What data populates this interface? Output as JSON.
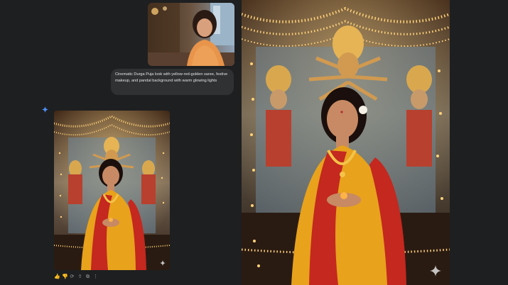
{
  "chat": {
    "prompt_text": "Cinematic Durga Puja look with yellow-red-golden saree, festive makeup, and pandal background with warm glowing lights"
  },
  "icons": {
    "assistant": "gemini-spark-icon",
    "actions": [
      "thumbs-up-icon",
      "thumbs-down-icon",
      "regenerate-icon",
      "share-icon",
      "copy-icon",
      "more-options-icon"
    ],
    "actions_glyphs": [
      "👍",
      "👎",
      "⟳",
      "⇧",
      "⧉",
      "⋮"
    ],
    "watermark": "sparkle-watermark-icon"
  },
  "colors": {
    "background": "#1e1f20",
    "bubble": "#2f3133",
    "saree_yellow": "#e8a21c",
    "saree_red": "#c4281f",
    "gold": "#f3c34a"
  }
}
